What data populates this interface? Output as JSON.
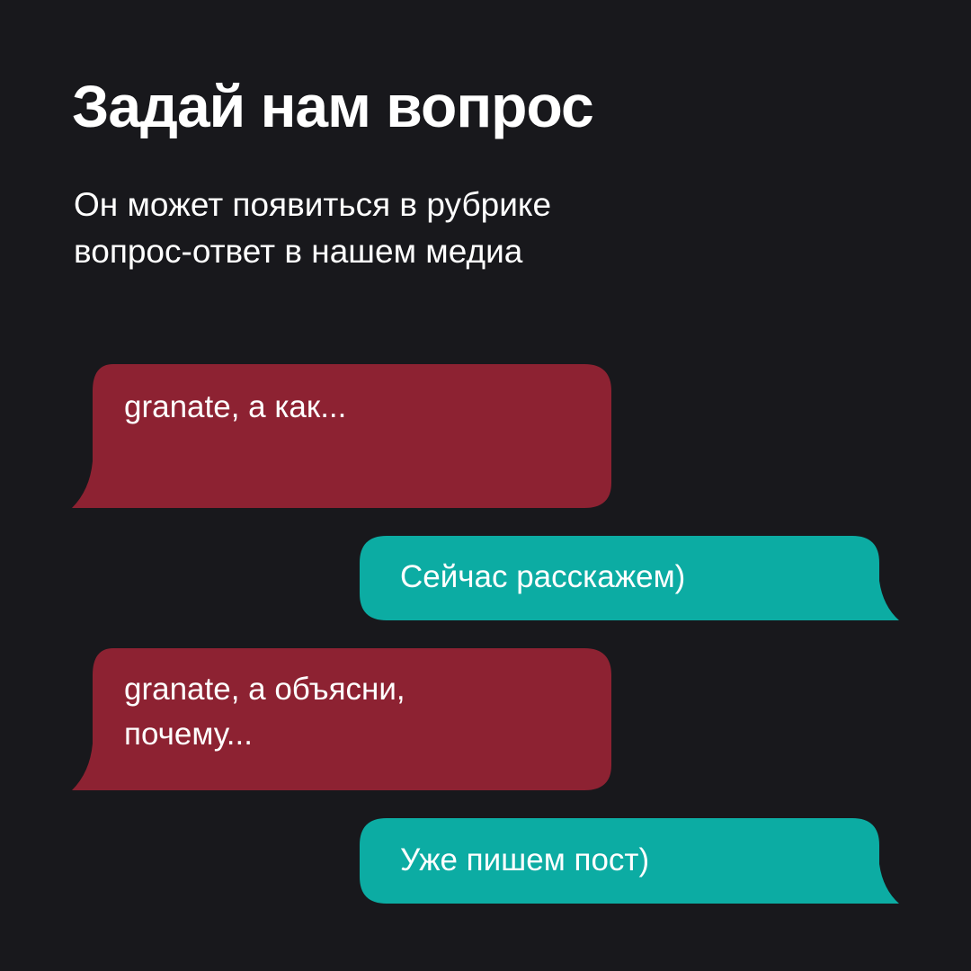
{
  "header": {
    "title": "Задай нам вопрос",
    "subtitle_lines": [
      "Он может появиться в рубрике",
      "вопрос-ответ в нашем медиа"
    ]
  },
  "messages": [
    {
      "direction": "incoming",
      "lines": [
        "granate, а как..."
      ]
    },
    {
      "direction": "outgoing",
      "lines": [
        "Сейчас расскажем)"
      ]
    },
    {
      "direction": "incoming",
      "lines": [
        "granate, а объясни,",
        "почему..."
      ]
    },
    {
      "direction": "outgoing",
      "lines": [
        "Уже пишем пост)"
      ]
    }
  ],
  "colors": {
    "background": "#18181c",
    "incoming_bubble": "#8d2232",
    "outgoing_bubble": "#0caca3",
    "text": "#ffffff"
  }
}
